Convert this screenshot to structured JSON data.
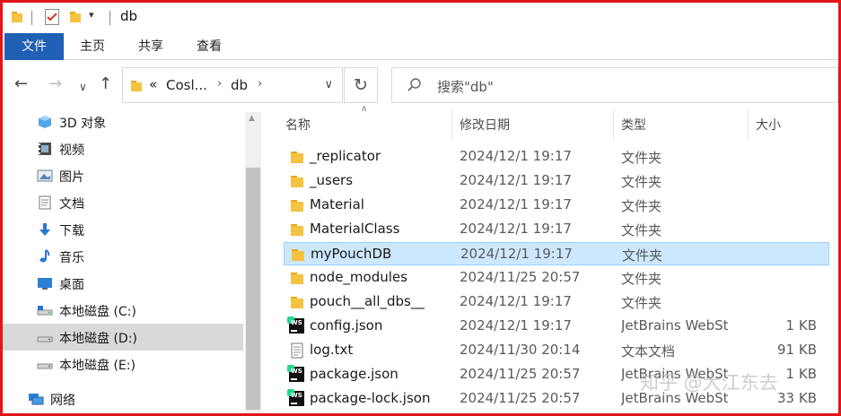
{
  "window": {
    "title": "db"
  },
  "ribbon": {
    "tabs": [
      "文件",
      "主页",
      "共享",
      "查看"
    ]
  },
  "navbar": {
    "back_icon": "back-arrow-icon",
    "forward_icon": "forward-arrow-icon",
    "recent_icon": "chevron-down-icon",
    "up_icon": "up-arrow-icon",
    "address": {
      "overflow": "«",
      "segments": [
        "Cosl...",
        "db"
      ]
    },
    "refresh_icon": "refresh-icon",
    "search": {
      "placeholder": "搜索\"db\""
    }
  },
  "navpane": {
    "items": [
      {
        "label": "3D 对象",
        "icon": "3d-objects-icon"
      },
      {
        "label": "视频",
        "icon": "video-icon"
      },
      {
        "label": "图片",
        "icon": "pictures-icon"
      },
      {
        "label": "文档",
        "icon": "documents-icon"
      },
      {
        "label": "下载",
        "icon": "download-icon"
      },
      {
        "label": "音乐",
        "icon": "music-icon"
      },
      {
        "label": "桌面",
        "icon": "desktop-icon"
      },
      {
        "label": "本地磁盘 (C:)",
        "icon": "drive-icon"
      },
      {
        "label": "本地磁盘 (D:)",
        "icon": "drive-icon",
        "selected": true
      },
      {
        "label": "本地磁盘 (E:)",
        "icon": "drive-icon"
      },
      {
        "label": "网络",
        "icon": "network-icon"
      }
    ]
  },
  "filelist": {
    "columns": {
      "name": "名称",
      "date": "修改日期",
      "type": "类型",
      "size": "大小"
    },
    "rows": [
      {
        "name": "_replicator",
        "date": "2024/12/1 19:17",
        "type": "文件夹",
        "size": "",
        "icon": "folder-icon"
      },
      {
        "name": "_users",
        "date": "2024/12/1 19:17",
        "type": "文件夹",
        "size": "",
        "icon": "folder-icon"
      },
      {
        "name": "Material",
        "date": "2024/12/1 19:17",
        "type": "文件夹",
        "size": "",
        "icon": "folder-icon"
      },
      {
        "name": "MaterialClass",
        "date": "2024/12/1 19:17",
        "type": "文件夹",
        "size": "",
        "icon": "folder-icon"
      },
      {
        "name": "myPouchDB",
        "date": "2024/12/1 19:17",
        "type": "文件夹",
        "size": "",
        "icon": "folder-icon",
        "selected": true
      },
      {
        "name": "node_modules",
        "date": "2024/11/25 20:57",
        "type": "文件夹",
        "size": "",
        "icon": "folder-icon"
      },
      {
        "name": "pouch__all_dbs__",
        "date": "2024/12/1 19:17",
        "type": "文件夹",
        "size": "",
        "icon": "folder-icon"
      },
      {
        "name": "config.json",
        "date": "2024/12/1 19:17",
        "type": "JetBrains WebSt...",
        "size": "1 KB",
        "icon": "webstorm-file-icon"
      },
      {
        "name": "log.txt",
        "date": "2024/11/30 20:14",
        "type": "文本文档",
        "size": "91 KB",
        "icon": "text-file-icon"
      },
      {
        "name": "package.json",
        "date": "2024/11/25 20:57",
        "type": "JetBrains WebSt...",
        "size": "1 KB",
        "icon": "webstorm-file-icon"
      },
      {
        "name": "package-lock.json",
        "date": "2024/11/25 20:57",
        "type": "JetBrains WebSt...",
        "size": "33 KB",
        "icon": "webstorm-file-icon"
      }
    ]
  },
  "watermark": "知乎 @大江东去",
  "colors": {
    "accent": "#1f5fb4",
    "selection": "#cce8ff",
    "frame": "#e3161b",
    "folder": "#f5c342"
  }
}
